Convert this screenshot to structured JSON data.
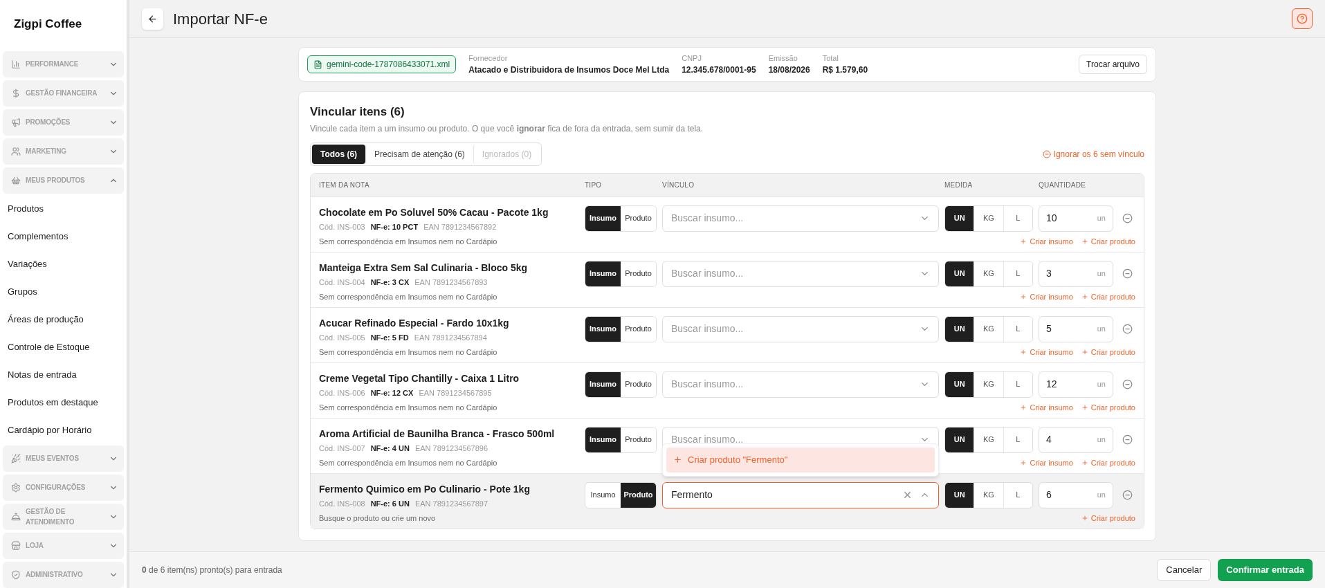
{
  "brand": "Zigpi Coffee",
  "sidebar": [
    {
      "label": "PERFORMANCE",
      "expanded": false
    },
    {
      "label": "GESTÃO FINANCEIRA",
      "expanded": false
    },
    {
      "label": "PROMOÇÕES",
      "expanded": false
    },
    {
      "label": "MARKETING",
      "expanded": false
    },
    {
      "label": "MEUS PRODUTOS",
      "expanded": true,
      "children": [
        "Produtos",
        "Complementos",
        "Variações",
        "Grupos",
        "Áreas de produção",
        "Controle de Estoque",
        "Notas de entrada",
        "Produtos em destaque",
        "Cardápio por Horário"
      ]
    },
    {
      "label": "MEUS EVENTOS",
      "expanded": false
    },
    {
      "label": "CONFIGURAÇÕES",
      "expanded": false
    },
    {
      "label": "GESTÃO DE ATENDIMENTO",
      "expanded": false
    },
    {
      "label": "LOJA",
      "expanded": false
    },
    {
      "label": "ADMINISTRATIVO",
      "expanded": false
    }
  ],
  "page": {
    "title": "Importar NF-e"
  },
  "file_bar": {
    "file": "gemini-code-1787086433071.xml",
    "fields": [
      {
        "label": "Fornecedor",
        "value": "Atacado e Distribuidora de Insumos Doce Mel Ltda"
      },
      {
        "label": "CNPJ",
        "value": "12.345.678/0001-95"
      },
      {
        "label": "Emissão",
        "value": "18/08/2026"
      },
      {
        "label": "Total",
        "value": "R$ 1.579,60"
      }
    ],
    "button": "Trocar arquivo"
  },
  "link_card": {
    "title": "Vincular itens (6)",
    "subtitle": "Vincule cada item a um insumo ou produto. O que você **ignorar** fica de fora da entrada, sem sumir da tela.",
    "tabs": [
      {
        "label": "Todos (6)",
        "selected": true,
        "disabled": false
      },
      {
        "label": "Precisam de atenção (6)",
        "selected": false,
        "disabled": false
      },
      {
        "label": "Ignorados (0)",
        "selected": false,
        "disabled": true
      }
    ],
    "ignore_link": "Ignorar os 6 sem vínculo",
    "columns": [
      "ITEM DA NOTA",
      "TIPO",
      "VÍNCULO",
      "MEDIDA",
      "QUANTIDADE"
    ],
    "rows": [
      {
        "name": "Chocolate em Po Soluvel 50% Cacau - Pacote 1kg",
        "code": "Cód. INS-003",
        "nfe": "NF-e: 10 PCT",
        "ean": "EAN 7891234567892",
        "note": "Sem correspondência em Insumos nem no Cardápio",
        "highlighted": false,
        "types": [
          {
            "label": "Insumo",
            "selected": true
          },
          {
            "label": "Produto",
            "selected": false
          }
        ],
        "search": {
          "placeholder": "Buscar insumo...",
          "open": false
        },
        "units": [
          {
            "label": "UN",
            "selected": true
          },
          {
            "label": "KG",
            "selected": false
          },
          {
            "label": "L",
            "selected": false
          }
        ],
        "quantity": {
          "value": "10",
          "unit": "un"
        },
        "actions": [
          "Criar insumo",
          "Criar produto"
        ]
      },
      {
        "name": "Manteiga Extra Sem Sal Culinaria - Bloco 5kg",
        "code": "Cód. INS-004",
        "nfe": "NF-e: 3 CX",
        "ean": "EAN 7891234567893",
        "note": "Sem correspondência em Insumos nem no Cardápio",
        "highlighted": false,
        "types": [
          {
            "label": "Insumo",
            "selected": true
          },
          {
            "label": "Produto",
            "selected": false
          }
        ],
        "search": {
          "placeholder": "Buscar insumo...",
          "open": false
        },
        "units": [
          {
            "label": "UN",
            "selected": true
          },
          {
            "label": "KG",
            "selected": false
          },
          {
            "label": "L",
            "selected": false
          }
        ],
        "quantity": {
          "value": "3",
          "unit": "un"
        },
        "actions": [
          "Criar insumo",
          "Criar produto"
        ]
      },
      {
        "name": "Acucar Refinado Especial - Fardo 10x1kg",
        "code": "Cód. INS-005",
        "nfe": "NF-e: 5 FD",
        "ean": "EAN 7891234567894",
        "note": "Sem correspondência em Insumos nem no Cardápio",
        "highlighted": false,
        "types": [
          {
            "label": "Insumo",
            "selected": true
          },
          {
            "label": "Produto",
            "selected": false
          }
        ],
        "search": {
          "placeholder": "Buscar insumo...",
          "open": false
        },
        "units": [
          {
            "label": "UN",
            "selected": true
          },
          {
            "label": "KG",
            "selected": false
          },
          {
            "label": "L",
            "selected": false
          }
        ],
        "quantity": {
          "value": "5",
          "unit": "un"
        },
        "actions": [
          "Criar insumo",
          "Criar produto"
        ]
      },
      {
        "name": "Creme Vegetal Tipo Chantilly - Caixa 1 Litro",
        "code": "Cód. INS-006",
        "nfe": "NF-e: 12 CX",
        "ean": "EAN 7891234567895",
        "note": "Sem correspondência em Insumos nem no Cardápio",
        "highlighted": false,
        "types": [
          {
            "label": "Insumo",
            "selected": true
          },
          {
            "label": "Produto",
            "selected": false
          }
        ],
        "search": {
          "placeholder": "Buscar insumo...",
          "open": false
        },
        "units": [
          {
            "label": "UN",
            "selected": true
          },
          {
            "label": "KG",
            "selected": false
          },
          {
            "label": "L",
            "selected": false
          }
        ],
        "quantity": {
          "value": "12",
          "unit": "un"
        },
        "actions": [
          "Criar insumo",
          "Criar produto"
        ]
      },
      {
        "name": "Aroma Artificial de Baunilha Branca - Frasco 500ml",
        "code": "Cód. INS-007",
        "nfe": "NF-e: 4 UN",
        "ean": "EAN 7891234567896",
        "note": "Sem correspondência em Insumos nem no Cardápio",
        "highlighted": false,
        "types": [
          {
            "label": "Insumo",
            "selected": true
          },
          {
            "label": "Produto",
            "selected": false
          }
        ],
        "search": {
          "placeholder": "Buscar insumo...",
          "open": false
        },
        "units": [
          {
            "label": "UN",
            "selected": true
          },
          {
            "label": "KG",
            "selected": false
          },
          {
            "label": "L",
            "selected": false
          }
        ],
        "quantity": {
          "value": "4",
          "unit": "un"
        },
        "actions": [
          "Criar insumo",
          "Criar produto"
        ]
      },
      {
        "name": "Fermento Quimico em Po Culinario - Pote 1kg",
        "code": "Cód. INS-008",
        "nfe": "NF-e: 6 UN",
        "ean": "EAN 7891234567897",
        "note": "Busque o produto ou crie um novo",
        "highlighted": true,
        "types": [
          {
            "label": "Insumo",
            "selected": false
          },
          {
            "label": "Produto",
            "selected": true
          }
        ],
        "search": {
          "value": "Fermento",
          "open": true,
          "options": [
            "Criar produto \"Fermento\""
          ]
        },
        "units": [
          {
            "label": "UN",
            "selected": true
          },
          {
            "label": "KG",
            "selected": false
          },
          {
            "label": "L",
            "selected": false
          }
        ],
        "quantity": {
          "value": "6",
          "unit": "un"
        },
        "actions": [
          "Criar produto"
        ]
      }
    ]
  },
  "footer": {
    "status": "**0** de 6 item(ns) pronto(s) para entrada",
    "buttons": [
      {
        "label": "Cancelar",
        "kind": "secondary"
      },
      {
        "label": "Confirmar entrada",
        "kind": "primary"
      }
    ]
  }
}
